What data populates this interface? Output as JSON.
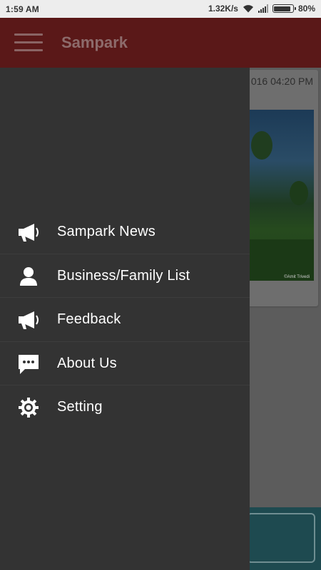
{
  "status_bar": {
    "time": "1:59 AM",
    "network_speed": "1.32K/s",
    "battery": "80%",
    "battery_level": 0.8,
    "icons": [
      "wifi-icon",
      "signal-icon",
      "battery-icon"
    ]
  },
  "app_bar": {
    "title": "Sampark",
    "background_color": "#5a1818",
    "menu_icon": "hamburger-icon"
  },
  "background_content": {
    "date_partial": "016 04:20 PM",
    "photo_credit": "©Amit Trivedi"
  },
  "drawer": {
    "background_color": "#333333",
    "items": [
      {
        "label": "Sampark News",
        "icon": "megaphone-icon"
      },
      {
        "label": "Business/Family List",
        "icon": "person-icon"
      },
      {
        "label": "Feedback",
        "icon": "megaphone-icon"
      },
      {
        "label": "About Us",
        "icon": "chat-bubble-icon"
      },
      {
        "label": "Setting",
        "icon": "gear-icon"
      }
    ]
  }
}
